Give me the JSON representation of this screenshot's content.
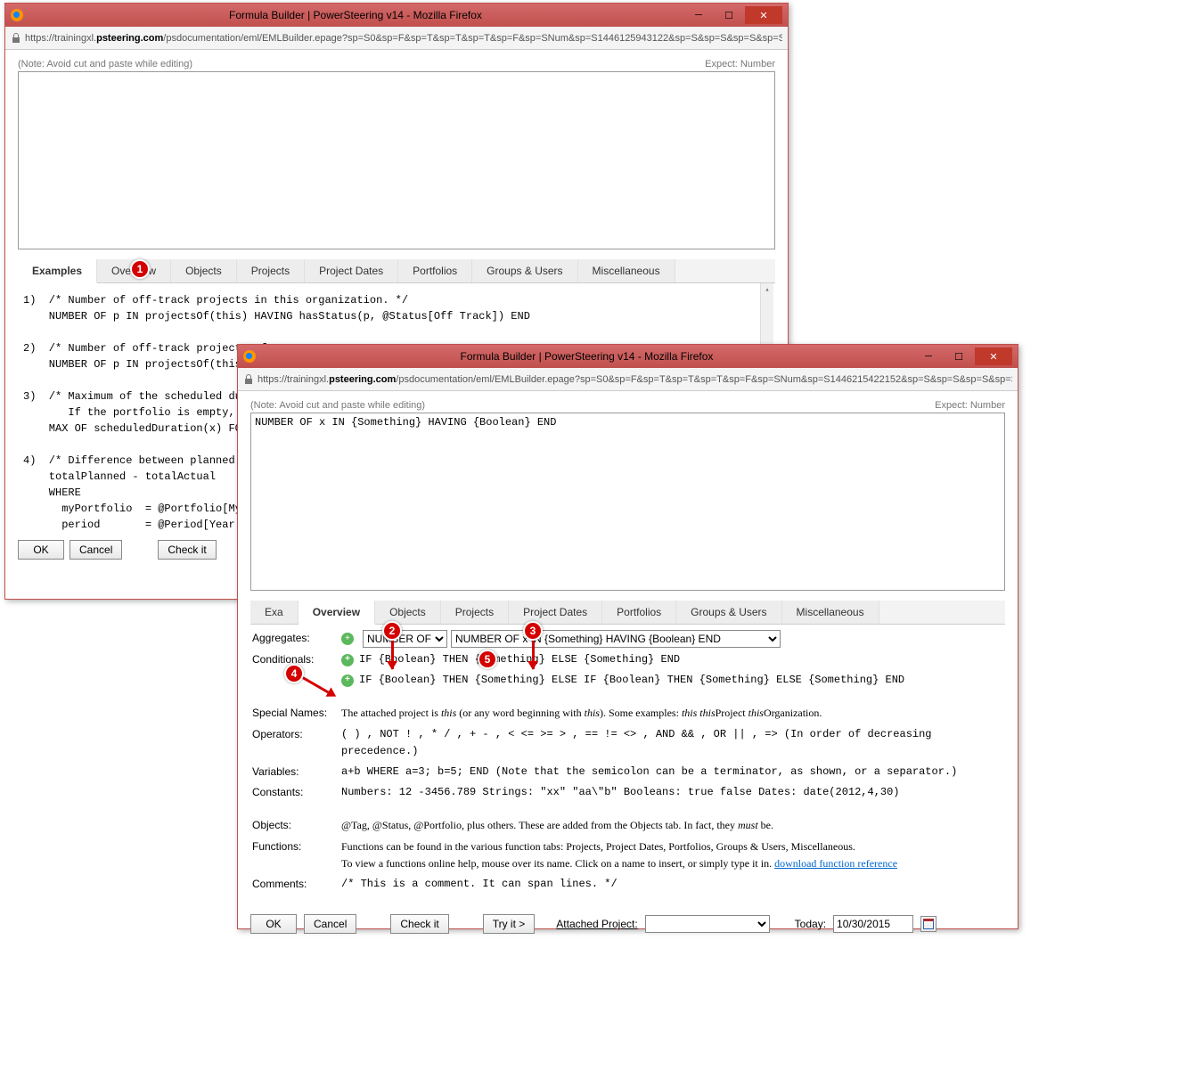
{
  "win1": {
    "title": "Formula Builder | PowerSteering v14 - Mozilla Firefox",
    "url_pre": "https://trainingxl.",
    "url_bold": "psteering.com",
    "url_post": "/psdocumentation/eml/EMLBuilder.epage?sp=S0&sp=F&sp=T&sp=T&sp=T&sp=F&sp=SNum&sp=S1446125943122&sp=S&sp=S&sp=S&sp=S&sp=S&",
    "hint_note": "(Note: Avoid cut and paste while editing)",
    "hint_expect": "Expect: Number",
    "editor_value": "",
    "tabs": [
      "Examples",
      "Overview",
      "Objects",
      "Projects",
      "Project Dates",
      "Portfolios",
      "Groups & Users",
      "Miscellaneous"
    ],
    "active_tab": 0,
    "examples": [
      "1)  /* Number of off-track projects in this organization. */\n    NUMBER OF p IN projectsOf(this) HAVING hasStatus(p, @Status[Off Track]) END",
      "2)  /* Number of off-track projects of\n    NUMBER OF p IN projectsOf(this, @W",
      "3)  /* Maximum of the scheduled durati\n       If the portfolio is empty, then\n    MAX OF scheduledDuration(x) FOR x",
      "4)  /* Difference between planned and \n    totalPlanned - totalActual\n    WHERE\n      myPortfolio  = @Portfolio[My Pro\n      period       = @Period[Year to D\n      totalPlanned = SUM of metricTota"
    ],
    "buttons": {
      "ok": "OK",
      "cancel": "Cancel",
      "check": "Check it"
    }
  },
  "win2": {
    "title": "Formula Builder | PowerSteering v14 - Mozilla Firefox",
    "url_pre": "https://trainingxl.",
    "url_bold": "psteering.com",
    "url_post": "/psdocumentation/eml/EMLBuilder.epage?sp=S0&sp=F&sp=T&sp=T&sp=T&sp=F&sp=SNum&sp=S1446215422152&sp=S&sp=S&sp=S&sp=S&sp=S&",
    "hint_note": "(Note: Avoid cut and paste while editing)",
    "hint_expect": "Expect: Number",
    "editor_value": "NUMBER OF x IN {Something} HAVING {Boolean} END",
    "tabs": [
      "Exa",
      "Overview",
      "Objects",
      "Projects",
      "Project Dates",
      "Portfolios",
      "Groups & Users",
      "Miscellaneous"
    ],
    "active_tab": 1,
    "aggregates_label": "Aggregates:",
    "aggregate_select": "NUMBER OF",
    "aggregate_expr": "NUMBER OF x IN {Something} HAVING {Boolean} END",
    "conditionals_label": "Conditionals:",
    "cond1": "IF {Boolean} THEN {Something} ELSE {Something} END",
    "cond2": "IF {Boolean} THEN {Something} ELSE IF {Boolean} THEN {Something} ELSE {Something} END",
    "rows": {
      "special_names": {
        "label": "Special Names:",
        "body": "The attached project is  <i>this</i> (or any word beginning with <i>this</i>).  Some examples:  <i>this  this</i>Project  <i>this</i>Organization."
      },
      "operators": {
        "label": "Operators:",
        "body": "( ) , NOT ! , * / , + - , < <= >= > , == != <> , AND && , OR || , =>   (In order of decreasing precedence.)"
      },
      "variables": {
        "label": "Variables:",
        "body": "a+b WHERE a=3; b=5; END   (Note that the semicolon can be a terminator, as shown, or a separator.)"
      },
      "constants": {
        "label": "Constants:",
        "body": "Numbers:  12  -3456.789    Strings:  \"xx\"  \"aa\\\"b\"    Booleans:  true  false    Dates:  date(2012,4,30)"
      },
      "objects": {
        "label": "Objects:",
        "body": "@Tag, @Status, @Portfolio, plus others. These are added from the Objects tab. In fact, they <i>must</i> be."
      },
      "functions": {
        "label": "Functions:",
        "body": "Functions can be found in the various function tabs: Projects, Project Dates, Portfolios, Groups & Users, Miscellaneous.<br>To view a functions online help, mouse over its name. Click on a name to insert, or simply type it in.  <span class='link'>download function reference</span>"
      },
      "comments": {
        "label": "Comments:",
        "body": "/* This is a comment.  It can span lines. */"
      }
    },
    "buttons": {
      "ok": "OK",
      "cancel": "Cancel",
      "check": "Check it",
      "try": "Try it >",
      "attached": "Attached Project:",
      "today": "Today:",
      "date": "10/30/2015"
    }
  },
  "callouts": {
    "1": "1",
    "2": "2",
    "3": "3",
    "4": "4",
    "5": "5"
  }
}
